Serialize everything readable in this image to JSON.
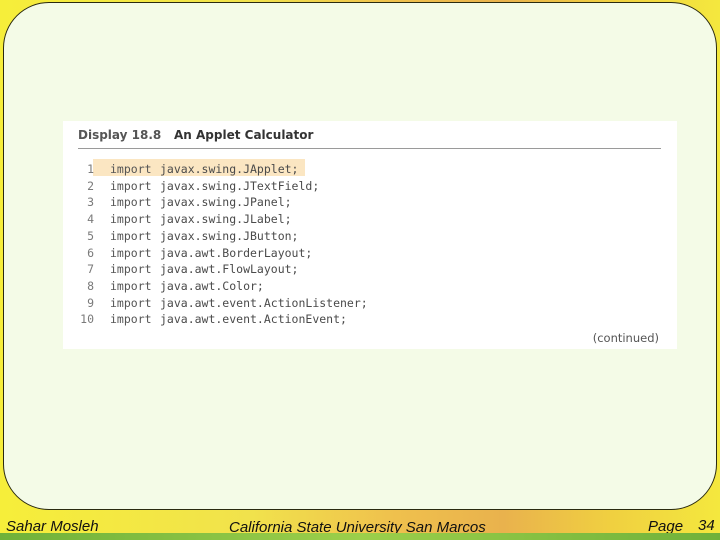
{
  "display": {
    "number": "Display 18.8",
    "title": "An Applet Calculator",
    "continued": "(continued)",
    "lines": [
      {
        "no": "1",
        "keyword": "import",
        "text": "javax.swing.JApplet;"
      },
      {
        "no": "2",
        "keyword": "import",
        "text": "javax.swing.JTextField;"
      },
      {
        "no": "3",
        "keyword": "import",
        "text": "javax.swing.JPanel;"
      },
      {
        "no": "4",
        "keyword": "import",
        "text": "javax.swing.JLabel;"
      },
      {
        "no": "5",
        "keyword": "import",
        "text": "javax.swing.JButton;"
      },
      {
        "no": "6",
        "keyword": "import",
        "text": "java.awt.BorderLayout;"
      },
      {
        "no": "7",
        "keyword": "import",
        "text": "java.awt.FlowLayout;"
      },
      {
        "no": "8",
        "keyword": "import",
        "text": "java.awt.Color;"
      },
      {
        "no": "9",
        "keyword": "import",
        "text": "java.awt.event.ActionListener;"
      },
      {
        "no": "10",
        "keyword": "import",
        "text": "java.awt.event.ActionEvent;"
      }
    ]
  },
  "footer": {
    "author": "Sahar Mosleh",
    "institution": "California State University San Marcos",
    "page_label": "Page",
    "page_number": "34"
  }
}
